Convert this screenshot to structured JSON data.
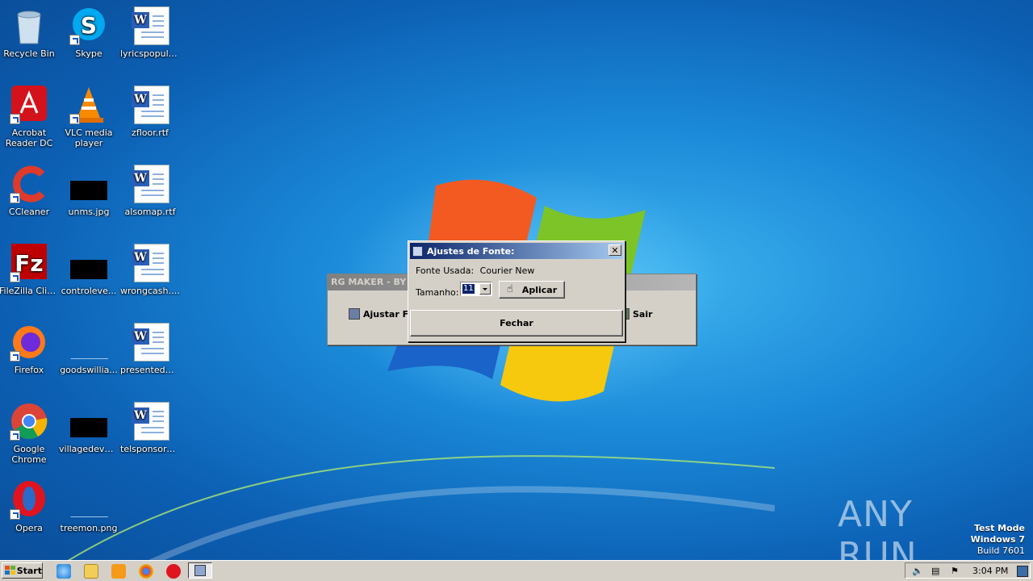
{
  "desktop": {
    "icons": [
      {
        "label": "Recycle Bin"
      },
      {
        "label": "Skype"
      },
      {
        "label": "lyricspopula..."
      },
      {
        "label": "Acrobat Reader DC"
      },
      {
        "label": "VLC media player"
      },
      {
        "label": "zfloor.rtf"
      },
      {
        "label": "CCleaner"
      },
      {
        "label": "unms.jpg"
      },
      {
        "label": "alsomap.rtf"
      },
      {
        "label": "FileZilla Client"
      },
      {
        "label": "controleve..."
      },
      {
        "label": "wrongcash.rtf"
      },
      {
        "label": "Firefox"
      },
      {
        "label": "goodswillia..."
      },
      {
        "label": "presentedml..."
      },
      {
        "label": "Google Chrome"
      },
      {
        "label": "villagedevel..."
      },
      {
        "label": "telsponsore..."
      },
      {
        "label": "Opera"
      },
      {
        "label": "treemon.png"
      }
    ]
  },
  "rg_window": {
    "title": "RG MAKER - BY G",
    "left_button": "Ajustar Fo",
    "right_button": "Sair"
  },
  "font_dialog": {
    "title": "Ajustes de Fonte:",
    "font_label": "Fonte Usada:",
    "font_value": "Courier New",
    "size_label": "Tamanho:",
    "size_value": "11",
    "apply_button": "Aplicar",
    "close_button": "Fechar"
  },
  "taskbar": {
    "start_label": "Start",
    "clock": "3:04 PM"
  },
  "watermark": {
    "line1": "Test Mode",
    "line2": "Windows 7",
    "line3": "Build 7601",
    "anyrun": "ANY RUN"
  }
}
